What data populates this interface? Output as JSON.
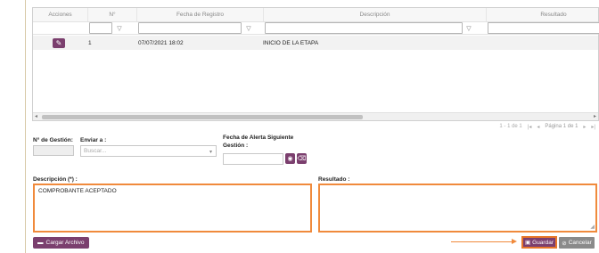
{
  "grid": {
    "columns": [
      "Acciones",
      "N°",
      "Fecha de Registro",
      "Descripción",
      "Resultado"
    ],
    "filter_icon": "filter-icon",
    "rows": [
      {
        "num": "1",
        "fecha": "07/07/2021 18:02",
        "descripcion": "INICIO DE LA ETAPA",
        "resultado": ""
      }
    ]
  },
  "pager": {
    "range": "1 - 1 de 1",
    "page": "Página 1 de 1"
  },
  "form": {
    "num_gestion_label": "N° de Gestión:",
    "enviar_label": "Enviar a :",
    "enviar_placeholder": "Buscar...",
    "fecha_alerta_label_1": "Fecha de Alerta Siguiente",
    "fecha_alerta_label_2": "Gestión :",
    "descripcion_label": "Descripción (*) :",
    "descripcion_value": "COMPROBANTE ACEPTADO",
    "resultado_label": "Resultado :",
    "resultado_value": ""
  },
  "buttons": {
    "cargar": "Cargar Archivo",
    "guardar": "Guardar",
    "cancelar": "Cancelar"
  },
  "colors": {
    "primary": "#7b3f6e",
    "highlight": "#f08a3c"
  }
}
